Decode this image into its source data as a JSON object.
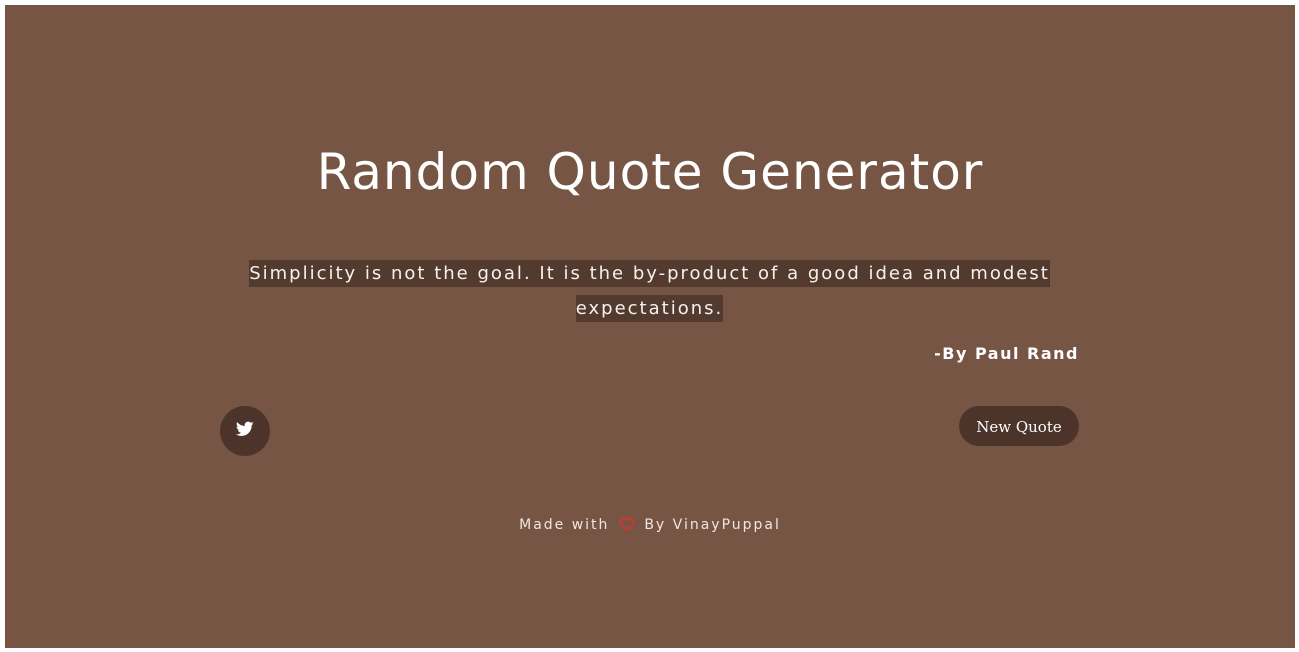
{
  "header": {
    "title": "Random Quote Generator"
  },
  "quote": {
    "text": "Simplicity is not the goal. It is the by-product of a good idea and modest expectations.",
    "author": "-By Paul Rand"
  },
  "actions": {
    "tweet_icon": "twitter-icon",
    "new_quote_label": "New Quote"
  },
  "footer": {
    "made_with": "Made with",
    "heart_icon": "heart-icon",
    "by_text": "By VinayPuppal"
  },
  "colors": {
    "background": "#775545",
    "quote_highlight": "#523a2f",
    "button": "#4c342a",
    "heart": "#d9332c",
    "text": "#ffffff"
  }
}
